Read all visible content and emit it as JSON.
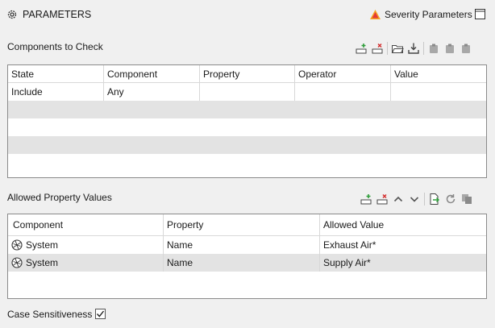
{
  "header": {
    "title": "PARAMETERS",
    "severity_label": "Severity Parameters"
  },
  "components": {
    "label": "Components to Check",
    "columns": [
      "State",
      "Component",
      "Property",
      "Operator",
      "Value"
    ],
    "rows": [
      [
        "Include",
        "Any",
        "",
        "",
        ""
      ]
    ]
  },
  "allowed": {
    "label": "Allowed Property Values",
    "columns": [
      "Component",
      "Property",
      "Allowed Value"
    ],
    "rows": [
      [
        "System",
        "Name",
        "Exhaust Air*"
      ],
      [
        "System",
        "Name",
        "Supply Air*"
      ]
    ]
  },
  "case": {
    "label": "Case Sensitiveness",
    "checked": true
  },
  "colors": {
    "severity_red": "#e53935",
    "severity_orange": "#f5a623",
    "add_green": "#2e9d3a",
    "remove_red": "#d32f2f"
  }
}
